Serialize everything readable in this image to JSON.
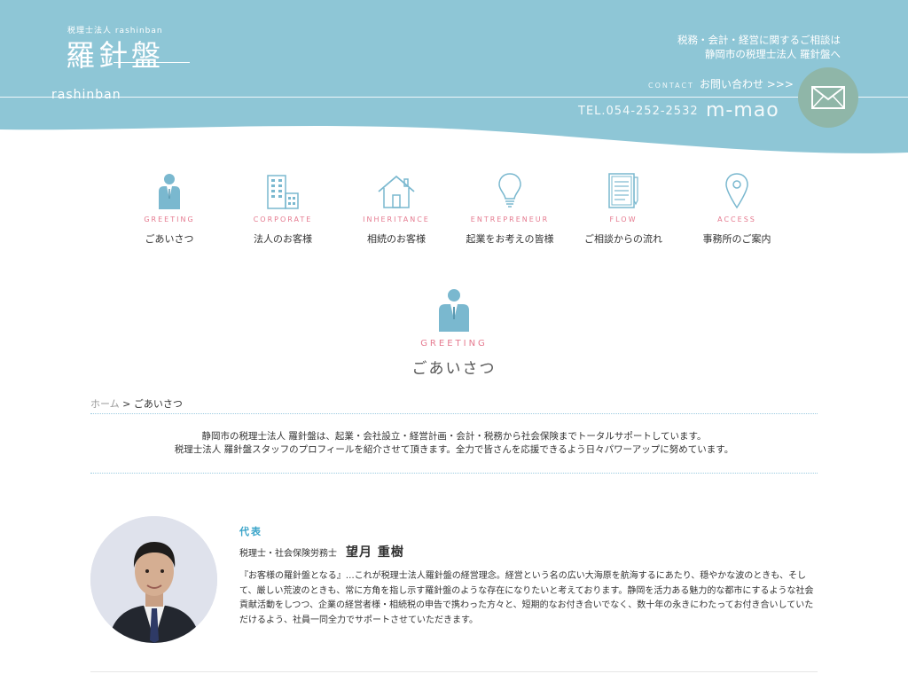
{
  "header": {
    "logo_small": "税理士法人 rashinban",
    "logo_main": "羅針盤",
    "logo_sub": "rashinban",
    "tagline_line1": "税務・会計・経営に関するご相談は",
    "tagline_line2": "静岡市の税理士法人 羅針盤へ",
    "contact_small": "CONTACT",
    "contact_label": "お問い合わせ >>>",
    "tel": "TEL.054-252-2532",
    "brand2": "m-mao"
  },
  "nav": {
    "items": [
      {
        "en": "GREETING",
        "jp": "ごあいさつ",
        "icon": "person-icon"
      },
      {
        "en": "CORPORATE",
        "jp": "法人のお客様",
        "icon": "building-icon"
      },
      {
        "en": "INHERITANCE",
        "jp": "相続のお客様",
        "icon": "house-icon"
      },
      {
        "en": "ENTREPRENEUR",
        "jp": "起業をお考えの皆様",
        "icon": "lightbulb-icon"
      },
      {
        "en": "FLOW",
        "jp": "ご相談からの流れ",
        "icon": "document-icon"
      },
      {
        "en": "ACCESS",
        "jp": "事務所のご案内",
        "icon": "map-pin-icon"
      }
    ]
  },
  "page": {
    "title_en": "GREETING",
    "title_jp": "ごあいさつ"
  },
  "breadcrumb": {
    "home": "ホーム",
    "separator": ">",
    "current": "ごあいさつ"
  },
  "intro": {
    "line1": "静岡市の税理士法人 羅針盤は、起業・会社設立・経営計画・会計・税務から社会保険までトータルサポートしています。",
    "line2": "税理士法人 羅針盤スタッフのプロフィールを紹介させて頂きます。全力で皆さんを応援できるよう日々パワーアップに努めています。"
  },
  "profile": {
    "role": "代表",
    "qualification": "税理士・社会保険労務士",
    "name": "望月 重樹",
    "bio": "『お客様の羅針盤となる』…これが税理士法人羅針盤の経営理念。経営という名の広い大海原を航海するにあたり、穏やかな波のときも、そして、厳しい荒波のときも、常に方角を指し示す羅針盤のような存在になりたいと考えております。静岡を活力ある魅力的な都市にするような社会貢献活動をしつつ、企業の経営者様・相続税の申告で携わった方々と、短期的なお付き合いでなく、数十年の永きにわたってお付き合いしていただけるよう、社員一同全力でサポートさせていただきます。"
  },
  "colors": {
    "header_blue": "#8ec6d6",
    "accent_pink": "#e57a8f",
    "icon_blue": "#7ab8cf",
    "role_blue": "#3aa4c9",
    "mail_green": "#8fb6a8"
  }
}
